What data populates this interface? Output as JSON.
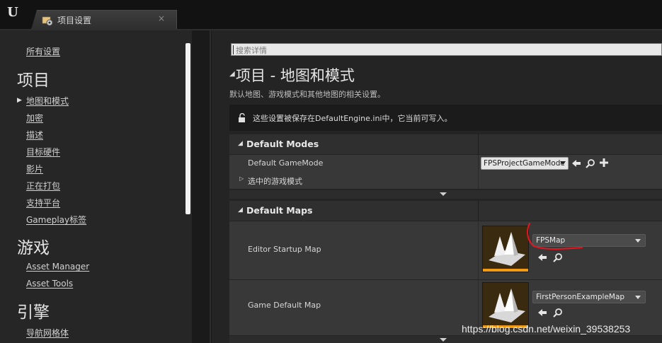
{
  "window": {
    "tab_title": "项目设置",
    "tab_close": "×"
  },
  "sidebar": {
    "all_settings": "所有设置",
    "sections": [
      {
        "heading": "项目",
        "items": [
          "地图和模式",
          "加密",
          "描述",
          "目标硬件",
          "影片",
          "正在打包",
          "支持平台",
          "Gameplay标签"
        ]
      },
      {
        "heading": "游戏",
        "items": [
          "Asset Manager",
          "Asset Tools"
        ]
      },
      {
        "heading": "引擎",
        "items": [
          "导航网格体"
        ]
      }
    ]
  },
  "search": {
    "placeholder": "搜索详情"
  },
  "page": {
    "title": "项目 - 地图和模式",
    "description": "默认地图、游戏模式和其他地图的相关设置。",
    "notice": "这些设置被保存在DefaultEngine.ini中，它当前可写入。"
  },
  "default_modes": {
    "heading": "Default Modes",
    "game_mode_label": "Default GameMode",
    "game_mode_value": "FPSProjectGameMode",
    "selected_mode_label": "选中的游戏模式"
  },
  "default_maps": {
    "heading": "Default Maps",
    "editor_startup_label": "Editor Startup Map",
    "editor_startup_value": "FPSMap",
    "game_default_label": "Game Default Map",
    "game_default_value": "FirstPersonExampleMap"
  },
  "watermark": "https://blog.csdn.net/weixin_39538253",
  "colors": {
    "accent_orange": "#f29a12",
    "annotation_red": "#e8141e"
  }
}
